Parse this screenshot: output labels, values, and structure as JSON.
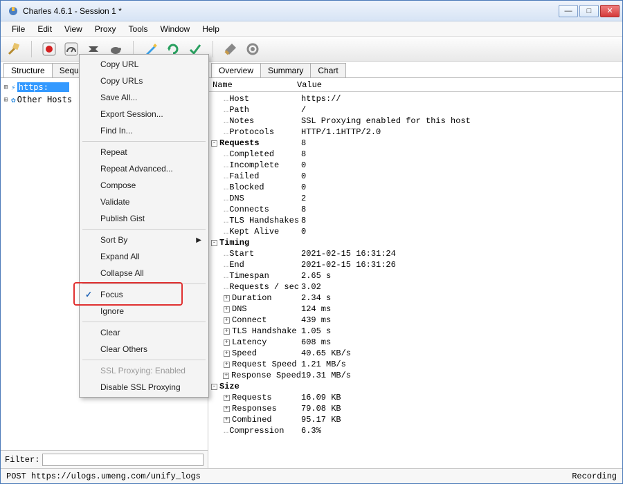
{
  "window": {
    "title": "Charles 4.6.1 - Session 1 *"
  },
  "menubar": [
    "File",
    "Edit",
    "View",
    "Proxy",
    "Tools",
    "Window",
    "Help"
  ],
  "leftTabs": [
    "Structure",
    "Sequence"
  ],
  "tree": {
    "item1_label": "https:",
    "item1_blur": "         ",
    "item2_label": "Other Hosts"
  },
  "contextMenu": {
    "items": [
      {
        "label": "Copy URL"
      },
      {
        "label": "Copy URLs"
      },
      {
        "label": "Save All..."
      },
      {
        "label": "Export Session..."
      },
      {
        "label": "Find In..."
      },
      {
        "sep": true
      },
      {
        "label": "Repeat"
      },
      {
        "label": "Repeat Advanced..."
      },
      {
        "label": "Compose"
      },
      {
        "label": "Validate"
      },
      {
        "label": "Publish Gist"
      },
      {
        "sep": true
      },
      {
        "label": "Sort By",
        "submenu": true
      },
      {
        "label": "Expand All"
      },
      {
        "label": "Collapse All"
      },
      {
        "sep": true
      },
      {
        "label": "Focus",
        "checked": true
      },
      {
        "label": "Ignore"
      },
      {
        "sep": true
      },
      {
        "label": "Clear"
      },
      {
        "label": "Clear Others"
      },
      {
        "sep": true
      },
      {
        "label": "SSL Proxying: Enabled",
        "disabled": true
      },
      {
        "label": "Disable SSL Proxying"
      }
    ]
  },
  "rightTabs": [
    "Overview",
    "Summary",
    "Chart"
  ],
  "overviewHeader": {
    "col1": "Name",
    "col2": "Value"
  },
  "overview": [
    {
      "indent": 1,
      "lbl": "Host",
      "val": "https://",
      "blurafter": "        "
    },
    {
      "indent": 1,
      "lbl": "Path",
      "val": "/"
    },
    {
      "indent": 1,
      "lbl": "Notes",
      "val": "SSL Proxying enabled for this host"
    },
    {
      "indent": 1,
      "lbl": "Protocols",
      "val": "HTTP/1.1HTTP/2.0"
    },
    {
      "indent": 0,
      "pm": "-",
      "lbl": "Requests",
      "val": "8",
      "bold": true
    },
    {
      "indent": 1,
      "lbl": "Completed",
      "val": "8"
    },
    {
      "indent": 1,
      "lbl": "Incomplete",
      "val": "0"
    },
    {
      "indent": 1,
      "lbl": "Failed",
      "val": "0"
    },
    {
      "indent": 1,
      "lbl": "Blocked",
      "val": "0"
    },
    {
      "indent": 1,
      "lbl": "DNS",
      "val": "2"
    },
    {
      "indent": 1,
      "lbl": "Connects",
      "val": "8"
    },
    {
      "indent": 1,
      "lbl": "TLS Handshakes",
      "val": "8"
    },
    {
      "indent": 1,
      "lbl": "Kept Alive",
      "val": "0"
    },
    {
      "indent": 0,
      "pm": "-",
      "lbl": "Timing",
      "val": "",
      "bold": true
    },
    {
      "indent": 1,
      "lbl": "Start",
      "val": "2021-02-15 16:31:24"
    },
    {
      "indent": 1,
      "lbl": "End",
      "val": "2021-02-15 16:31:26"
    },
    {
      "indent": 1,
      "lbl": "Timespan",
      "val": "2.65 s"
    },
    {
      "indent": 1,
      "lbl": "Requests / sec",
      "val": "3.02"
    },
    {
      "indent": 1,
      "pm": "+",
      "lbl": "Duration",
      "val": "2.34 s"
    },
    {
      "indent": 1,
      "pm": "+",
      "lbl": "DNS",
      "val": "124 ms"
    },
    {
      "indent": 1,
      "pm": "+",
      "lbl": "Connect",
      "val": "439 ms"
    },
    {
      "indent": 1,
      "pm": "+",
      "lbl": "TLS Handshake",
      "val": "1.05 s"
    },
    {
      "indent": 1,
      "pm": "+",
      "lbl": "Latency",
      "val": "608 ms"
    },
    {
      "indent": 1,
      "pm": "+",
      "lbl": "Speed",
      "val": "40.65 KB/s"
    },
    {
      "indent": 1,
      "pm": "+",
      "lbl": "Request Speed",
      "val": "1.21 MB/s"
    },
    {
      "indent": 1,
      "pm": "+",
      "lbl": "Response Speed",
      "val": "19.31 MB/s"
    },
    {
      "indent": 0,
      "pm": "-",
      "lbl": "Size",
      "val": "",
      "bold": true
    },
    {
      "indent": 1,
      "pm": "+",
      "lbl": "Requests",
      "val": "16.09 KB"
    },
    {
      "indent": 1,
      "pm": "+",
      "lbl": "Responses",
      "val": "79.08 KB"
    },
    {
      "indent": 1,
      "pm": "+",
      "lbl": "Combined",
      "val": "95.17 KB"
    },
    {
      "indent": 1,
      "lbl": "Compression",
      "val": "6.3%"
    }
  ],
  "filter": {
    "label": "Filter:",
    "value": ""
  },
  "status": {
    "left": "POST https://ulogs.umeng.com/unify_logs",
    "right": "Recording"
  }
}
